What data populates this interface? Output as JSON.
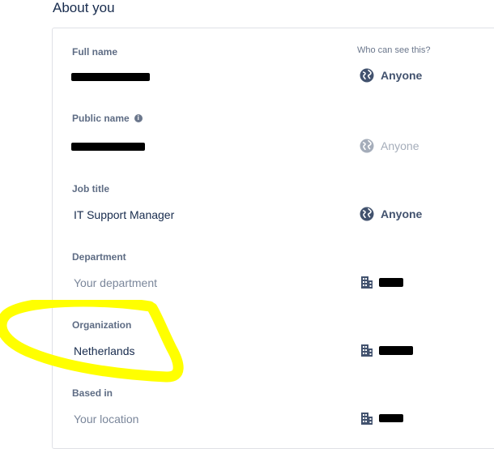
{
  "section_title": "About you",
  "who_label": "Who can see this?",
  "fields": [
    {
      "label": "Full name",
      "value": "",
      "visibility": "Anyone"
    },
    {
      "label": "Public name",
      "value": "",
      "visibility": "Anyone"
    },
    {
      "label": "Job title",
      "value": "IT Support Manager",
      "visibility": "Anyone"
    },
    {
      "label": "Department",
      "placeholder": "Your department"
    },
    {
      "label": "Organization",
      "value": "Netherlands"
    },
    {
      "label": "Based in",
      "placeholder": "Your location"
    }
  ],
  "colors": {
    "highlight": "#ffff00",
    "icon": "#42526e",
    "icon_disabled": "#a5adba"
  },
  "icons": {
    "globe": "globe-icon",
    "building": "building-icon",
    "info": "info-icon"
  }
}
